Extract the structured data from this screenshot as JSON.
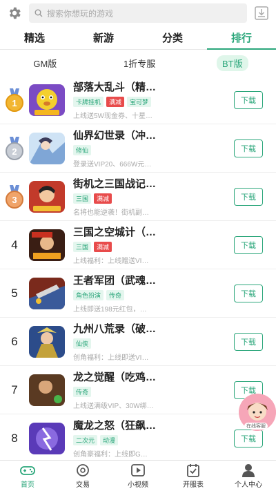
{
  "search": {
    "placeholder": "搜索你想玩的游戏"
  },
  "tabs": [
    {
      "label": "精选"
    },
    {
      "label": "新游"
    },
    {
      "label": "分类"
    },
    {
      "label": "排行",
      "active": true
    }
  ],
  "subtabs": [
    {
      "label": "GM版"
    },
    {
      "label": "1折专服"
    },
    {
      "label": "BT版",
      "active": true
    }
  ],
  "games": [
    {
      "rank": "1",
      "name": "部落大乱斗（精…",
      "tags": [
        {
          "t": "卡牌挂机"
        },
        {
          "t": "满减",
          "red": true
        },
        {
          "t": "宝可梦"
        }
      ],
      "desc": "上线送5W现金券、十星…",
      "button": "下载"
    },
    {
      "rank": "2",
      "name": "仙界幻世录（冲…",
      "tags": [
        {
          "t": "修仙"
        }
      ],
      "desc": "登录送VIP20、666W元…",
      "button": "下载"
    },
    {
      "rank": "3",
      "name": "街机之三国战记…",
      "tags": [
        {
          "t": "三国"
        },
        {
          "t": "满减",
          "red": true
        }
      ],
      "desc": "名将也能逆袭！街机副…",
      "button": "下载"
    },
    {
      "rank": "4",
      "name": "三国之空城计（…",
      "tags": [
        {
          "t": "三国"
        },
        {
          "t": "满减",
          "red": true
        }
      ],
      "desc": "上线福利：上线赠送VI…",
      "button": "下载"
    },
    {
      "rank": "5",
      "name": "王者军团（武魂…",
      "tags": [
        {
          "t": "角色扮演"
        },
        {
          "t": "传奇"
        }
      ],
      "desc": "上线即送198元红包，…",
      "button": "下载"
    },
    {
      "rank": "6",
      "name": "九州八荒录（破…",
      "tags": [
        {
          "t": "仙侠"
        }
      ],
      "desc": "创角福利：上线即送VI…",
      "button": "下载"
    },
    {
      "rank": "7",
      "name": "龙之觉醒（吃鸡…",
      "tags": [
        {
          "t": "传奇"
        }
      ],
      "desc": "上线送满级VIP、30W绑…",
      "button": "下载"
    },
    {
      "rank": "8",
      "name": "魔龙之怒（狂飙…",
      "tags": [
        {
          "t": "二次元"
        },
        {
          "t": "动漫"
        }
      ],
      "desc": "创角豪福利：上线即G…",
      "button": "下载"
    }
  ],
  "float_ad": {
    "label": "在线客服"
  },
  "bottom_nav": [
    {
      "label": "首页",
      "icon": "gamepad-icon",
      "active": true
    },
    {
      "label": "交易",
      "icon": "trade-icon"
    },
    {
      "label": "小视频",
      "icon": "video-icon"
    },
    {
      "label": "开服表",
      "icon": "calendar-icon"
    },
    {
      "label": "个人中心",
      "icon": "user-icon"
    }
  ],
  "colors": {
    "accent": "#2aa67a",
    "red_tag": "#e84b4b",
    "gold": "#f2b632",
    "silver": "#b9bfc8",
    "bronze": "#e8955a"
  }
}
